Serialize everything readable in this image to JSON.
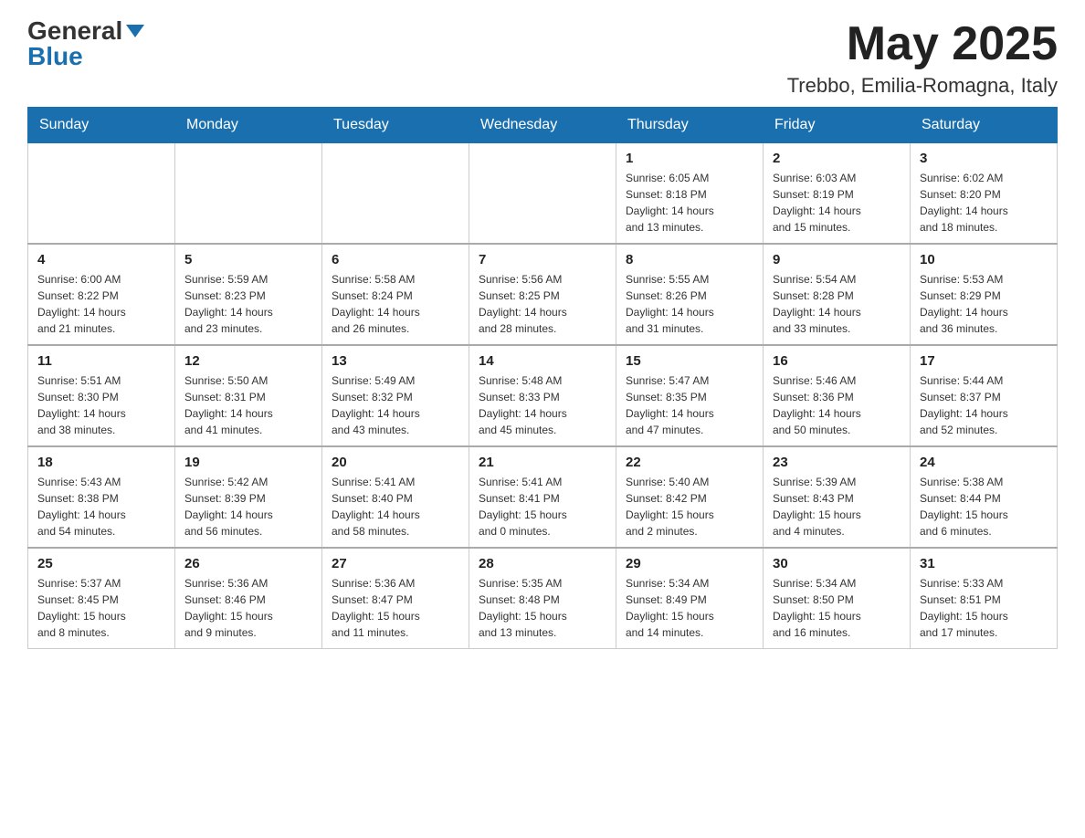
{
  "header": {
    "logo_general": "General",
    "logo_blue": "Blue",
    "month_title": "May 2025",
    "location": "Trebbo, Emilia-Romagna, Italy"
  },
  "days_of_week": [
    "Sunday",
    "Monday",
    "Tuesday",
    "Wednesday",
    "Thursday",
    "Friday",
    "Saturday"
  ],
  "weeks": [
    [
      {
        "day": "",
        "info": ""
      },
      {
        "day": "",
        "info": ""
      },
      {
        "day": "",
        "info": ""
      },
      {
        "day": "",
        "info": ""
      },
      {
        "day": "1",
        "info": "Sunrise: 6:05 AM\nSunset: 8:18 PM\nDaylight: 14 hours\nand 13 minutes."
      },
      {
        "day": "2",
        "info": "Sunrise: 6:03 AM\nSunset: 8:19 PM\nDaylight: 14 hours\nand 15 minutes."
      },
      {
        "day": "3",
        "info": "Sunrise: 6:02 AM\nSunset: 8:20 PM\nDaylight: 14 hours\nand 18 minutes."
      }
    ],
    [
      {
        "day": "4",
        "info": "Sunrise: 6:00 AM\nSunset: 8:22 PM\nDaylight: 14 hours\nand 21 minutes."
      },
      {
        "day": "5",
        "info": "Sunrise: 5:59 AM\nSunset: 8:23 PM\nDaylight: 14 hours\nand 23 minutes."
      },
      {
        "day": "6",
        "info": "Sunrise: 5:58 AM\nSunset: 8:24 PM\nDaylight: 14 hours\nand 26 minutes."
      },
      {
        "day": "7",
        "info": "Sunrise: 5:56 AM\nSunset: 8:25 PM\nDaylight: 14 hours\nand 28 minutes."
      },
      {
        "day": "8",
        "info": "Sunrise: 5:55 AM\nSunset: 8:26 PM\nDaylight: 14 hours\nand 31 minutes."
      },
      {
        "day": "9",
        "info": "Sunrise: 5:54 AM\nSunset: 8:28 PM\nDaylight: 14 hours\nand 33 minutes."
      },
      {
        "day": "10",
        "info": "Sunrise: 5:53 AM\nSunset: 8:29 PM\nDaylight: 14 hours\nand 36 minutes."
      }
    ],
    [
      {
        "day": "11",
        "info": "Sunrise: 5:51 AM\nSunset: 8:30 PM\nDaylight: 14 hours\nand 38 minutes."
      },
      {
        "day": "12",
        "info": "Sunrise: 5:50 AM\nSunset: 8:31 PM\nDaylight: 14 hours\nand 41 minutes."
      },
      {
        "day": "13",
        "info": "Sunrise: 5:49 AM\nSunset: 8:32 PM\nDaylight: 14 hours\nand 43 minutes."
      },
      {
        "day": "14",
        "info": "Sunrise: 5:48 AM\nSunset: 8:33 PM\nDaylight: 14 hours\nand 45 minutes."
      },
      {
        "day": "15",
        "info": "Sunrise: 5:47 AM\nSunset: 8:35 PM\nDaylight: 14 hours\nand 47 minutes."
      },
      {
        "day": "16",
        "info": "Sunrise: 5:46 AM\nSunset: 8:36 PM\nDaylight: 14 hours\nand 50 minutes."
      },
      {
        "day": "17",
        "info": "Sunrise: 5:44 AM\nSunset: 8:37 PM\nDaylight: 14 hours\nand 52 minutes."
      }
    ],
    [
      {
        "day": "18",
        "info": "Sunrise: 5:43 AM\nSunset: 8:38 PM\nDaylight: 14 hours\nand 54 minutes."
      },
      {
        "day": "19",
        "info": "Sunrise: 5:42 AM\nSunset: 8:39 PM\nDaylight: 14 hours\nand 56 minutes."
      },
      {
        "day": "20",
        "info": "Sunrise: 5:41 AM\nSunset: 8:40 PM\nDaylight: 14 hours\nand 58 minutes."
      },
      {
        "day": "21",
        "info": "Sunrise: 5:41 AM\nSunset: 8:41 PM\nDaylight: 15 hours\nand 0 minutes."
      },
      {
        "day": "22",
        "info": "Sunrise: 5:40 AM\nSunset: 8:42 PM\nDaylight: 15 hours\nand 2 minutes."
      },
      {
        "day": "23",
        "info": "Sunrise: 5:39 AM\nSunset: 8:43 PM\nDaylight: 15 hours\nand 4 minutes."
      },
      {
        "day": "24",
        "info": "Sunrise: 5:38 AM\nSunset: 8:44 PM\nDaylight: 15 hours\nand 6 minutes."
      }
    ],
    [
      {
        "day": "25",
        "info": "Sunrise: 5:37 AM\nSunset: 8:45 PM\nDaylight: 15 hours\nand 8 minutes."
      },
      {
        "day": "26",
        "info": "Sunrise: 5:36 AM\nSunset: 8:46 PM\nDaylight: 15 hours\nand 9 minutes."
      },
      {
        "day": "27",
        "info": "Sunrise: 5:36 AM\nSunset: 8:47 PM\nDaylight: 15 hours\nand 11 minutes."
      },
      {
        "day": "28",
        "info": "Sunrise: 5:35 AM\nSunset: 8:48 PM\nDaylight: 15 hours\nand 13 minutes."
      },
      {
        "day": "29",
        "info": "Sunrise: 5:34 AM\nSunset: 8:49 PM\nDaylight: 15 hours\nand 14 minutes."
      },
      {
        "day": "30",
        "info": "Sunrise: 5:34 AM\nSunset: 8:50 PM\nDaylight: 15 hours\nand 16 minutes."
      },
      {
        "day": "31",
        "info": "Sunrise: 5:33 AM\nSunset: 8:51 PM\nDaylight: 15 hours\nand 17 minutes."
      }
    ]
  ]
}
